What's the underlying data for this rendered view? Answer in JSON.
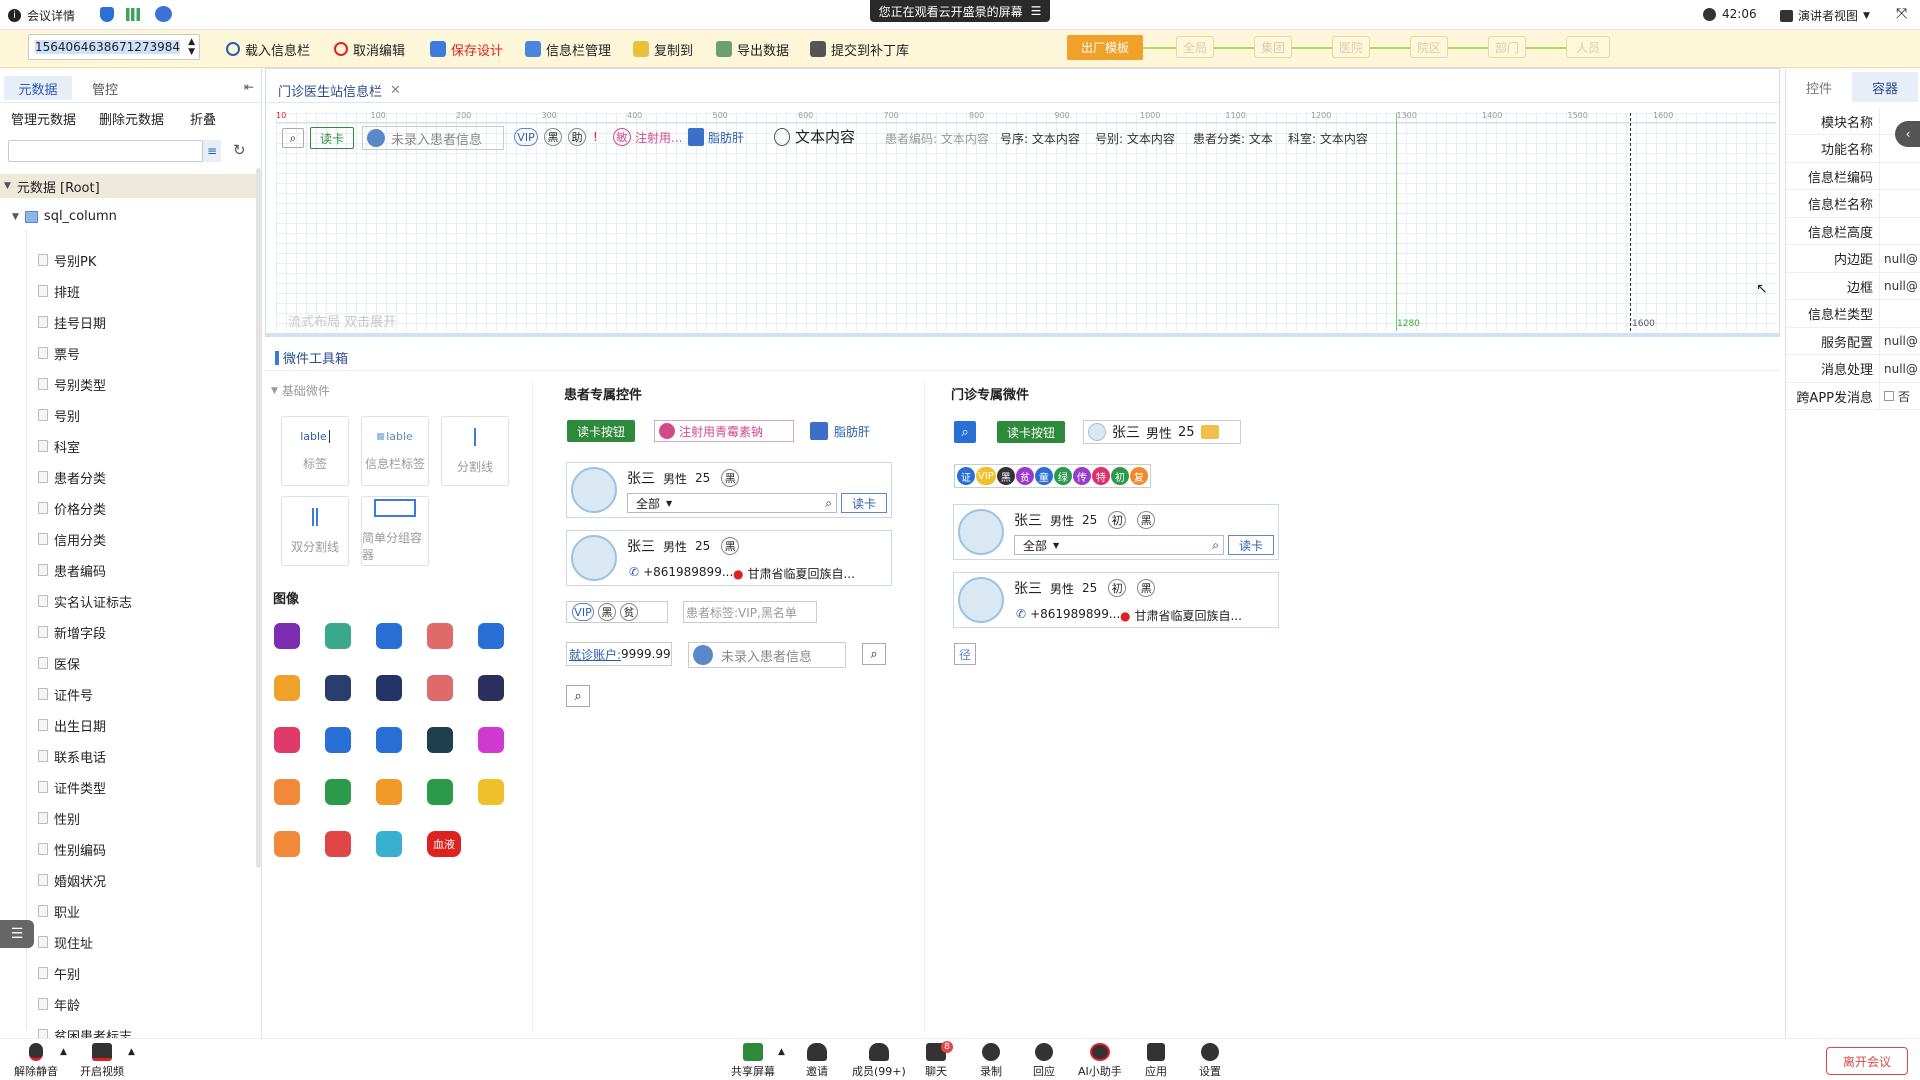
{
  "topbar": {
    "meeting_details": "会议详情",
    "screen_share_notice": "您正在观看云开盛景的屏幕",
    "clock": "42:06",
    "view_mode": "演讲者视图"
  },
  "toolbar": {
    "search_value": "1564064638671273984",
    "load_info_bar": "载入信息栏",
    "cancel_edit": "取消编辑",
    "save_design": "保存设计",
    "info_bar_manage": "信息栏管理",
    "copy_to": "复制到",
    "export_data": "导出数据",
    "submit_patch": "提交到补丁库",
    "factory_template": "出厂模板",
    "scope_chips": [
      "全局",
      "集团",
      "医院",
      "院区",
      "部门",
      "人员"
    ]
  },
  "left_panel": {
    "tabs": [
      "元数据",
      "管控"
    ],
    "actions": [
      "管理元数据",
      "删除元数据",
      "折叠"
    ],
    "root_label": "元数据 [Root]",
    "table_label": "sql_column",
    "items": [
      "号别PK",
      "排班",
      "挂号日期",
      "票号",
      "号别类型",
      "号别",
      "科室",
      "患者分类",
      "价格分类",
      "信用分类",
      "患者编码",
      "实名认证标志",
      "新增字段",
      "医保",
      "证件号",
      "出生日期",
      "联系电话",
      "证件类型",
      "性别",
      "性别编码",
      "婚姻状况",
      "职业",
      "现住址",
      "午别",
      "年龄",
      "贫困患者标志"
    ]
  },
  "canvas": {
    "tab_title": "门诊医生站信息栏",
    "ruler_labels": [
      "10",
      "100",
      "200",
      "300",
      "400",
      "500",
      "600",
      "700",
      "800",
      "900",
      "1000",
      "1100",
      "1200",
      "1300",
      "1400",
      "1500",
      "1600"
    ],
    "read_card": "读卡",
    "no_patient": "未录入患者信息",
    "tag_vip": "VIP",
    "tag_black": "黑",
    "tag_help": "助",
    "injection": "注射用...",
    "fatty_liver": "脂肪肝",
    "text_content": "文本内容",
    "fields": [
      "患者编码: 文本内容",
      "号序: 文本内容",
      "号别: 文本内容",
      "患者分类: 文本",
      "科室: 文本内容"
    ],
    "flow_layout_hint": "流式布局  双击展开",
    "guide_label_1": "1280",
    "guide_label_2": "1600"
  },
  "toolbox": {
    "title": "微件工具箱",
    "basic_widgets": "基础微件",
    "widgets": [
      "标签",
      "信息栏标签",
      "分割线",
      "双分割线",
      "简单分组容器"
    ],
    "widget_preview_label": "lable",
    "images_title": "图像",
    "blood_label": "血液",
    "patient_section": "患者专属控件",
    "read_card_button": "读卡按钮",
    "injection_label": "注射用青霉素钠",
    "fatty_liver": "脂肪肝",
    "patient_name": "张三",
    "patient_sex": "男性",
    "patient_age": "25",
    "select_all": "全部",
    "read_card": "读卡",
    "phone": "+861989899...",
    "address": "甘肃省临夏回族自...",
    "patient_tags_label": "患者标签:VIP,黑名单",
    "visit_account_label": "就诊账户:",
    "visit_account_value": "9999.99",
    "no_patient": "未录入患者信息",
    "tag_black": "黑",
    "tag_poor": "贫",
    "tag_first": "初",
    "outpatient_section": "门诊专属微件",
    "colored_tags": [
      "证",
      "VIP",
      "黑",
      "贫",
      "童",
      "绿",
      "传",
      "特",
      "初",
      "复"
    ],
    "route_icon": "径"
  },
  "right_panel": {
    "tabs": [
      "控件",
      "容器"
    ],
    "props": [
      {
        "label": "模块名称",
        "value": ""
      },
      {
        "label": "功能名称",
        "value": ""
      },
      {
        "label": "信息栏编码",
        "value": ""
      },
      {
        "label": "信息栏名称",
        "value": ""
      },
      {
        "label": "信息栏高度",
        "value": ""
      },
      {
        "label": "内边距",
        "value": "null@"
      },
      {
        "label": "边框",
        "value": "null@"
      },
      {
        "label": "信息栏类型",
        "value": ""
      },
      {
        "label": "服务配置",
        "value": "null@"
      },
      {
        "label": "消息处理",
        "value": "null@"
      },
      {
        "label": "跨APP发消息",
        "value": "否"
      }
    ]
  },
  "bottom_bar": {
    "unmute": "解除静音",
    "start_video": "开启视频",
    "share_screen": "共享屏幕",
    "invite": "邀请",
    "members": "成员(99+)",
    "chat": "聊天",
    "chat_badge": "8",
    "record": "录制",
    "reactions": "回应",
    "ai_assistant": "AI小助手",
    "apps": "应用",
    "settings": "设置",
    "leave": "离开会议"
  },
  "colors": {
    "toolbar_bg": "#fdf6d9",
    "accent_orange": "#f0a12a",
    "accent_green": "#2c8a3a",
    "leave_red": "#e04646"
  }
}
